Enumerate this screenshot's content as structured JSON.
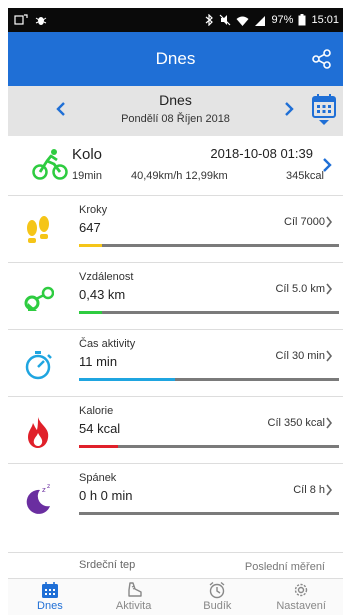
{
  "status_bar": {
    "bluetooth_icon": "bluetooth-icon",
    "battery": "97%",
    "time": "15:01"
  },
  "header": {
    "title": "Dnes"
  },
  "date_bar": {
    "title": "Dnes",
    "subtitle": "Pondělí 08 Říjen 2018"
  },
  "activity": {
    "name": "Kolo",
    "datetime": "2018-10-08 01:39",
    "duration": "19min",
    "speed_distance": "40,49km/h 12,99km",
    "calories": "345kcal"
  },
  "metrics": [
    {
      "label": "Kroky",
      "value": "647",
      "goal": "Cíl 7000",
      "progress": 0.09,
      "color": "#f5c518"
    },
    {
      "label": "Vzdálenost",
      "value": "0,43 km",
      "goal": "Cíl 5.0 km",
      "progress": 0.09,
      "color": "#2ecc40"
    },
    {
      "label": "Čas aktivity",
      "value": "11 min",
      "goal": "Cíl 30 min",
      "progress": 0.37,
      "color": "#1fa5e0"
    },
    {
      "label": "Kalorie",
      "value": "54 kcal",
      "goal": "Cíl 350 kcal",
      "progress": 0.15,
      "color": "#e0202a"
    },
    {
      "label": "Spánek",
      "value": "0 h 0 min",
      "goal": "Cíl 8 h",
      "progress": 0,
      "color": "#6a2ea0"
    }
  ],
  "partial_row": {
    "label": "Srdeční tep",
    "goal": "Poslední měření"
  },
  "bottom_nav": [
    {
      "label": "Dnes",
      "active": true
    },
    {
      "label": "Aktivita",
      "active": false
    },
    {
      "label": "Budík",
      "active": false
    },
    {
      "label": "Nastavení",
      "active": false
    }
  ],
  "colors": {
    "primary": "#1f6fd6",
    "activity_green": "#2ecc40"
  }
}
